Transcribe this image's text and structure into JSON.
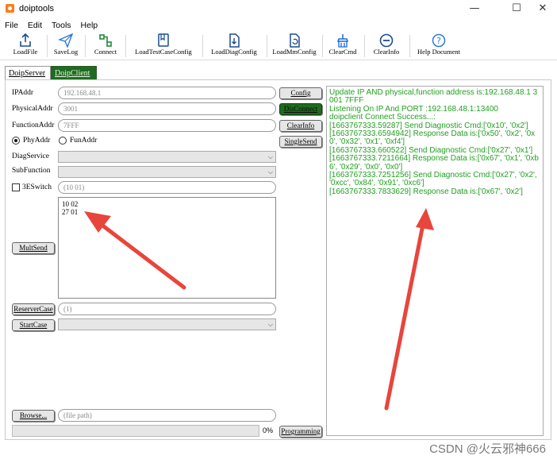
{
  "window": {
    "title": "doiptools",
    "minimize_glyph": "—",
    "maximize_glyph": "☐",
    "close_glyph": "✕"
  },
  "menu": [
    "File",
    "Edit",
    "Tools",
    "Help"
  ],
  "toolbar": [
    {
      "label": "LoadFile",
      "icon": "load-file-icon"
    },
    {
      "label": "SaveLog",
      "icon": "send-icon"
    },
    {
      "label": "Connect",
      "icon": "connect-icon"
    },
    {
      "label": "LoadTestCaseConfig",
      "icon": "book-icon"
    },
    {
      "label": "LoadDiagConfig",
      "icon": "file-download-icon"
    },
    {
      "label": "LoadMmConfig",
      "icon": "file-refresh-icon"
    },
    {
      "label": "ClearCmd",
      "icon": "broom-icon"
    },
    {
      "label": "ClearInfo",
      "icon": "minus-circle-icon"
    },
    {
      "label": "Help Document",
      "icon": "help-icon"
    }
  ],
  "tabs": [
    "DoipServer",
    "DoipClient"
  ],
  "form": {
    "ip_label": "IPAddr",
    "ip_value": "192.168.48.1",
    "physical_label": "PhysicalAddr",
    "physical_value": "3001",
    "function_label": "FunctionAddr",
    "function_value": "7FFF",
    "phy_radio": "PhyAddr",
    "fun_radio": "FunAddr",
    "diag_label": "DiagService",
    "sub_label": "SubFunction",
    "switch_label": "3ESwitch",
    "switch_value": "(10 01)",
    "multsend_text": "10 02\n27 01",
    "reserver_value": "(1)",
    "file_path_placeholder": "(file path)",
    "progress_text": "0%"
  },
  "buttons": {
    "config": "Config",
    "disconnect": "DisConnect",
    "clearinfo": "ClearInfo",
    "singlesend": "SingleSend",
    "multsend": "MultSend",
    "reservercase": "ReserverCase",
    "startcase": "StartCase",
    "browse": "Browse...",
    "programming": "Programming"
  },
  "progress": {
    "value": 0
  },
  "log": [
    "Update IP AND physical,function address is:192.168.48.1 3001 7FFF",
    "Listening On IP And PORT :192.168.48.1:13400",
    "doipclient Connect Success...:",
    "[1663767333.59287] Send Diagnostic Cmd:['0x10', '0x2']",
    "[1663767333.6594942] Response Data is:['0x50', '0x2', '0x0', '0x32', '0x1', '0xf4']",
    "[1663767333.660522] Send Diagnostic Cmd:['0x27', '0x1']",
    "[1663767333.7211664] Response Data is:['0x67', '0x1', '0xb6', '0x29', '0x0', '0x0']",
    "[1663767333.7251256] Send Diagnostic Cmd:['0x27', '0x2', '0xcc', '0x84', '0x91', '0xc6']",
    "[1663767333.7833629] Response Data is:['0x67', '0x2']"
  ],
  "watermark": "CSDN @火云邪神666",
  "colors": {
    "log_text": "#22a022",
    "connected_button": "#1f6b1f",
    "annotation_arrow": "#e8453c"
  }
}
